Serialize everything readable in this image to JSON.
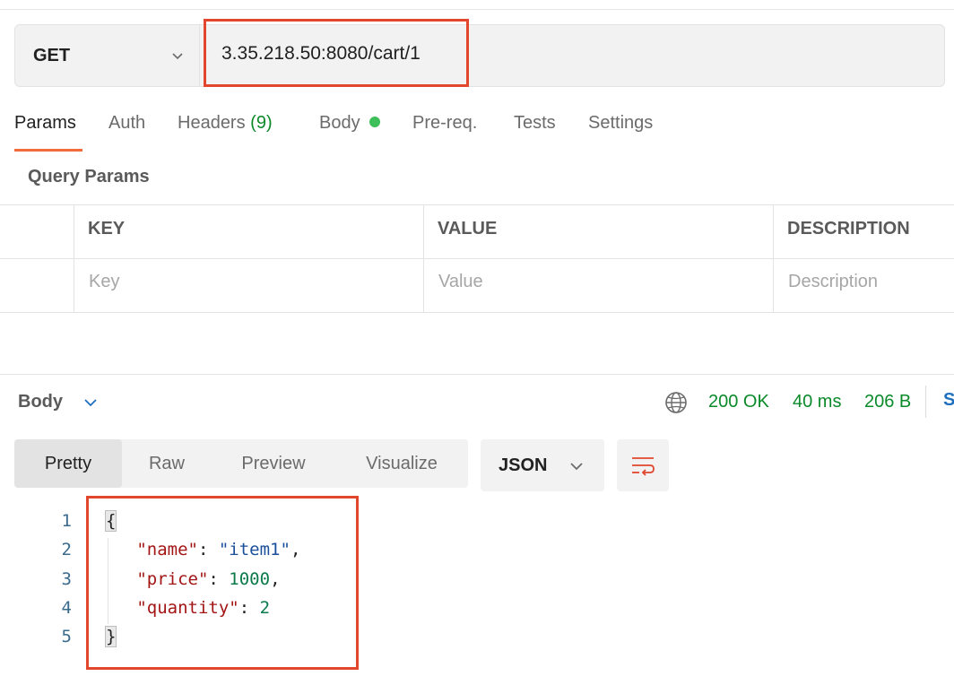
{
  "request": {
    "method": "GET",
    "url": "3.35.218.50:8080/cart/1"
  },
  "tabs": {
    "params": "Params",
    "auth": "Auth",
    "headers": "Headers",
    "headers_count": "(9)",
    "body": "Body",
    "prereq": "Pre-req.",
    "tests": "Tests",
    "settings": "Settings"
  },
  "query_params": {
    "title": "Query Params",
    "columns": [
      "KEY",
      "VALUE",
      "DESCRIPTION"
    ],
    "placeholders": [
      "Key",
      "Value",
      "Description"
    ]
  },
  "response": {
    "body_label": "Body",
    "status": "200 OK",
    "time": "40 ms",
    "size": "206 B",
    "save_letter": "S",
    "view_modes": [
      "Pretty",
      "Raw",
      "Preview",
      "Visualize"
    ],
    "format": "JSON",
    "line_numbers": [
      "1",
      "2",
      "3",
      "4",
      "5"
    ],
    "json": {
      "open": "{",
      "key_name": "\"name\"",
      "val_name": "\"item1\"",
      "key_price": "\"price\"",
      "val_price": "1000",
      "key_quantity": "\"quantity\"",
      "val_quantity": "2",
      "close": "}"
    }
  },
  "colors": {
    "accent": "#f26b3a",
    "highlight_box": "#e2462d",
    "status_green": "#0b8a2a"
  }
}
